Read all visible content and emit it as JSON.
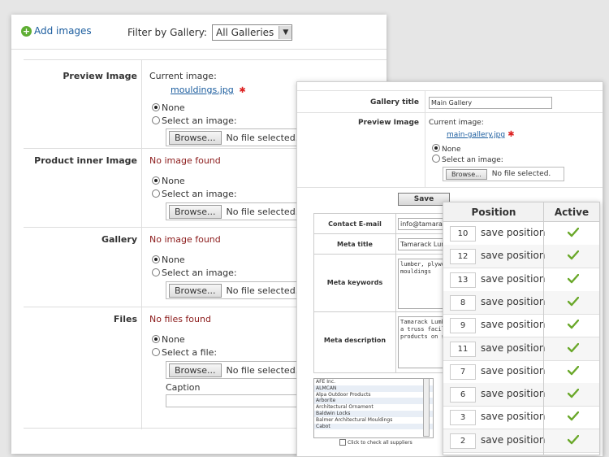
{
  "panel1": {
    "add_images": "Add images",
    "filter_label": "Filter by Gallery:",
    "filter_value": "All Galleries",
    "rows": [
      {
        "label": "Preview Image",
        "current_label": "Current image:",
        "file_link": "mouldings.jpg",
        "none": "None",
        "select": "Select an image:",
        "browse": "Browse...",
        "no_file": "No file selected."
      },
      {
        "label": "Product inner Image",
        "status": "No image found",
        "none": "None",
        "select": "Select an image:",
        "browse": "Browse...",
        "no_file": "No file selected."
      },
      {
        "label": "Gallery",
        "status": "No image found",
        "none": "None",
        "select": "Select an image:",
        "browse": "Browse...",
        "no_file": "No file selected."
      },
      {
        "label": "Files",
        "status": "No files found",
        "none": "None",
        "select": "Select a file:",
        "browse": "Browse...",
        "no_file": "No file selected.",
        "caption": "Caption"
      }
    ]
  },
  "panel2": {
    "gallery_title_label": "Gallery title",
    "gallery_title_value": "Main Gallery",
    "preview_label": "Preview Image",
    "current_label": "Current image:",
    "file_link": "main-gallery.jpg",
    "none": "None",
    "select": "Select an image:",
    "browse": "Browse...",
    "no_file": "No file selected.",
    "save": "Save",
    "contact_label": "Contact E-mail",
    "contact_value": "info@tamarackli",
    "meta_title_label": "Meta title",
    "meta_title_value": "Tamarack Lumb",
    "meta_keywords_label": "Meta keywords",
    "meta_keywords_value": "lumber, plywo\nmouldings",
    "meta_desc_label": "Meta description",
    "meta_desc_value": "Tamarack Lumb\na truss facil\nproducts on s",
    "suppliers": [
      "AFE Inc.",
      "ALMCAN",
      "Alpa Outdoor Products",
      "Arborite",
      "Architectural Ornament",
      "Baldwin Locks",
      "Balmer Architectural Mouldings",
      "Cabot"
    ],
    "check_all": "Click to check all suppliers"
  },
  "panel3": {
    "col_position": "Position",
    "col_active": "Active",
    "save_label": "save position",
    "positions": [
      "10",
      "12",
      "13",
      "8",
      "9",
      "11",
      "7",
      "6",
      "3",
      "2"
    ],
    "check_color": "#6aa82a"
  }
}
